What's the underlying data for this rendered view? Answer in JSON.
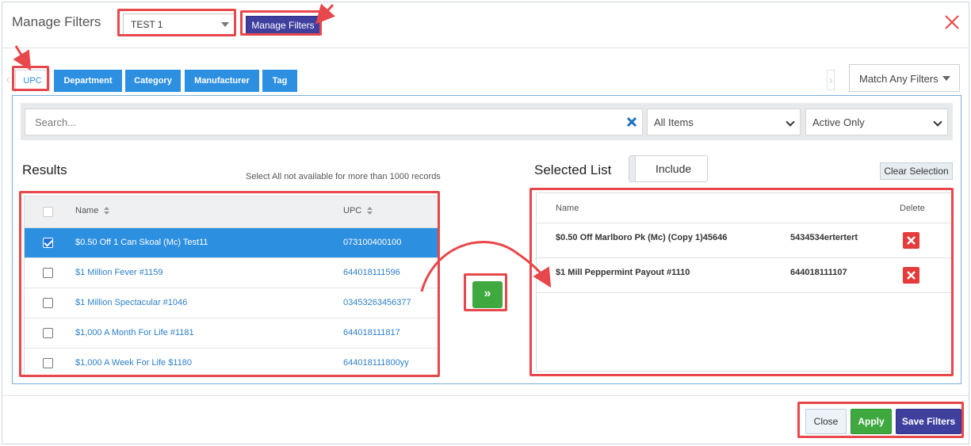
{
  "header": {
    "title": "Manage Filters",
    "filter_name": "TEST 1",
    "manage_button": "Manage Filters"
  },
  "tabs": [
    {
      "label": "UPC",
      "active": true
    },
    {
      "label": "Department"
    },
    {
      "label": "Category"
    },
    {
      "label": "Manufacturer"
    },
    {
      "label": "Tag"
    }
  ],
  "match_select": "Match Any Filters",
  "search": {
    "placeholder": "Search...",
    "items_select": "All Items",
    "status_select": "Active Only"
  },
  "results": {
    "title": "Results",
    "note": "Select All not available for more than 1000 records",
    "columns": [
      "Name",
      "UPC"
    ],
    "rows": [
      {
        "name": "$0.50 Off 1 Can Skoal (Mc) Test11",
        "upc": "073100400100",
        "checked": true
      },
      {
        "name": "$1 Million Fever #1159",
        "upc": "644018111596",
        "checked": false
      },
      {
        "name": "$1 Million Spectacular #1046",
        "upc": "03453263456377",
        "checked": false
      },
      {
        "name": "$1,000 A Month For Life #1181",
        "upc": "644018111817",
        "checked": false
      },
      {
        "name": "$1,000 A Week For Life $1180",
        "upc": "644018111800yy",
        "checked": false
      }
    ]
  },
  "move_button": "»",
  "selected": {
    "title": "Selected List",
    "toggle": "Include",
    "clear_button": "Clear Selection",
    "columns": [
      "Name",
      "Delete"
    ],
    "rows": [
      {
        "name": "$0.50 Off Marlboro Pk (Mc) (Copy 1)45646",
        "upc": "5434534ertertert"
      },
      {
        "name": "$1 Mill Peppermint Payout #1110",
        "upc": "644018111107"
      }
    ]
  },
  "footer": {
    "close": "Close",
    "apply": "Apply",
    "save": "Save Filters"
  },
  "colors": {
    "primary": "#2d8fe0",
    "indigo": "#3f3f9e",
    "green": "#3fa83f",
    "danger": "#e53b3b",
    "annotation": "#e8474b"
  }
}
